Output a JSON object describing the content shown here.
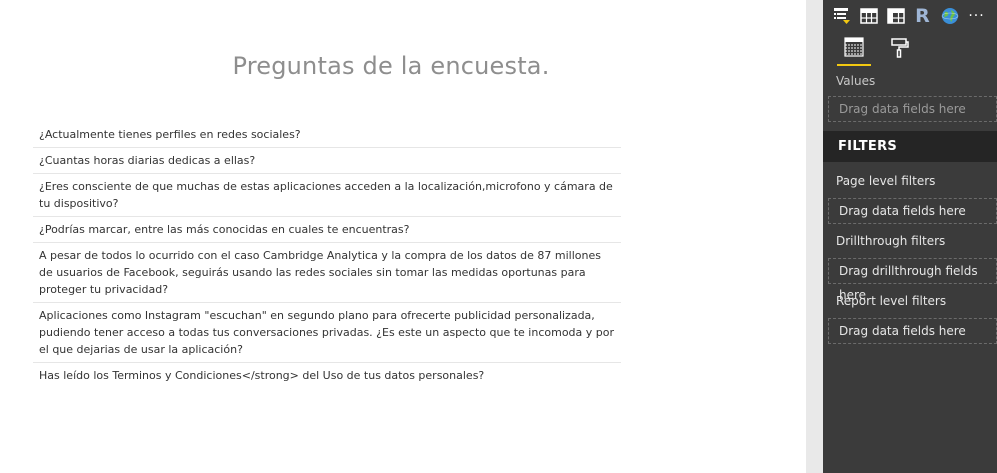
{
  "canvas": {
    "title": "Preguntas de la encuesta.",
    "questions": [
      "¿Actualmente tienes perfiles en redes sociales?",
      "¿Cuantas horas diarias dedicas a ellas?",
      "¿Eres consciente de que muchas de estas aplicaciones acceden a la localización,microfono y cámara de tu dispositivo?",
      "¿Podrías marcar, entre las más conocidas en cuales te encuentras?",
      "A pesar de todos lo ocurrido con el caso Cambridge Analytica y la compra de los datos de 87 millones de usuarios de Facebook, seguirás usando las redes sociales sin tomar las medidas oportunas para proteger tu privacidad?",
      "Aplicaciones como Instagram \"escuchan\" en segundo plano para ofrecerte publicidad personalizada, pudiendo tener acceso a todas tus conversaciones privadas. ¿Es este un aspecto que te incomoda y por el que dejarias de usar la aplicación?",
      "Has leído los Terminos y Condiciones</strong> del Uso de tus datos personales?"
    ]
  },
  "panel": {
    "viz_icons": [
      "slicer-icon",
      "table-icon",
      "matrix-icon",
      "r-script-icon",
      "globe-icon",
      "more-icon"
    ],
    "r_label": "R",
    "more_label": "···",
    "tabs": [
      {
        "icon": "fields-icon",
        "active": true
      },
      {
        "icon": "format-paint-roller-icon",
        "active": false
      }
    ],
    "values_label": "Values",
    "values_drop": "Drag data fields here",
    "filters_header": "FILTERS",
    "page_filters_label": "Page level filters",
    "page_filters_drop": "Drag data fields here",
    "drillthrough_label": "Drillthrough filters",
    "drillthrough_drop": "Drag drillthrough fields here",
    "report_filters_label": "Report level filters",
    "report_filters_drop": "Drag data fields here",
    "accent_color": "#f2c811"
  }
}
